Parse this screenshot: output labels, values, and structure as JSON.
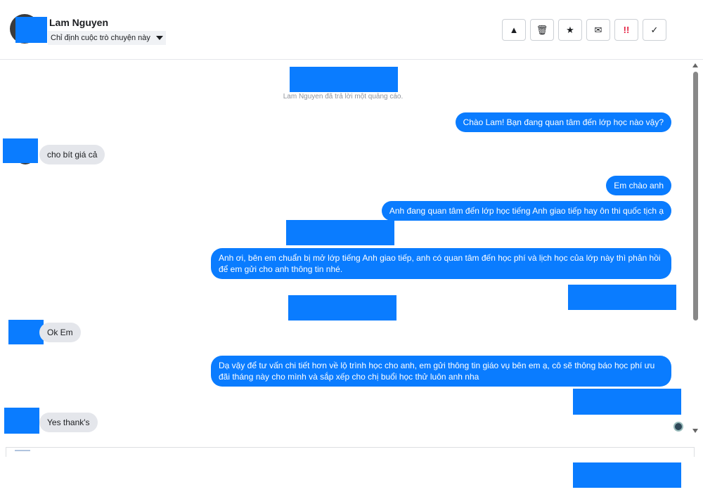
{
  "header": {
    "contact_name": "Lam Nguyen",
    "assign_label": "Chỉ định cuộc trò chuyện này",
    "tools": [
      {
        "icon": "warning-icon",
        "glyph": "▲"
      },
      {
        "icon": "trash-icon",
        "glyph": "🗑"
      },
      {
        "icon": "star-icon",
        "glyph": "★"
      },
      {
        "icon": "envelope-icon",
        "glyph": "✉"
      },
      {
        "icon": "priority-icon",
        "glyph": "!!"
      },
      {
        "icon": "check-icon",
        "glyph": "✓"
      }
    ]
  },
  "thread": {
    "system_note": "Lam Nguyen đã trả lời một quảng cáo.",
    "messages": [
      {
        "from": "page",
        "text": "Chào Lam! Bạn đang quan tâm đến lớp học nào vậy?"
      },
      {
        "from": "customer",
        "text": "cho bít giá cả"
      },
      {
        "from": "page",
        "text": "Em chào anh"
      },
      {
        "from": "page",
        "text": "Anh đang quan tâm đến lớp học tiếng Anh giao tiếp hay ôn thi quốc tịch ạ"
      },
      {
        "from": "page",
        "text": "Anh ơi, bên em chuẩn bị mở lớp tiếng Anh giao tiếp, anh có quan tâm đến học phí và lịch học của lớp này thì phản hồi để em gửi cho anh thông tin nhé."
      },
      {
        "from": "customer",
        "text": "Ok Em"
      },
      {
        "from": "page",
        "text": "Dạ vậy để tư vấn chi tiết hơn về lộ trình học cho anh, em gửi thông tin giáo vụ bên em ạ, cô sẽ thông báo học phí ưu đãi tháng này cho mình và sắp xếp cho chị buổi học thử luôn anh nha"
      },
      {
        "from": "customer",
        "text": "Yes thank's"
      }
    ]
  },
  "colors": {
    "accent": "#0a7cff",
    "incoming_bubble": "#e4e6eb",
    "redaction": "#0a7cff"
  }
}
